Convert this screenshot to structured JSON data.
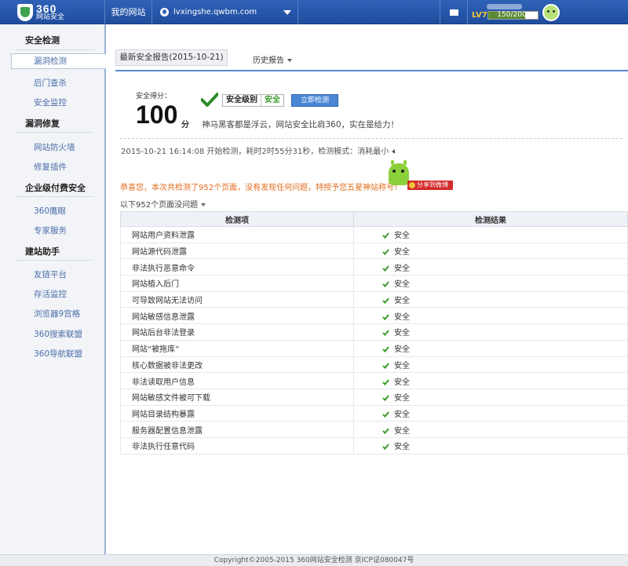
{
  "header": {
    "logo_main": "360",
    "logo_sub": "网站安全",
    "my_site": "我的网站",
    "site_url": "lvxingshe.qwbm.com",
    "level": "LV7",
    "exp_text": "150/200",
    "exp_progress": 0.75
  },
  "sidebar": {
    "groups": [
      {
        "title": "安全检测",
        "items": [
          "漏洞检测",
          "后门查杀",
          "安全监控"
        ]
      },
      {
        "title": "漏洞修复",
        "items": [
          "网站防火墙",
          "修复插件"
        ]
      },
      {
        "title": "企业级付费安全",
        "items": [
          "360鹰眼",
          "专家服务"
        ]
      },
      {
        "title": "建站助手",
        "items": [
          "友链平台",
          "存活监控",
          "浏览器9宫格",
          "360搜索联盟",
          "360导航联盟"
        ]
      }
    ]
  },
  "tabs": {
    "active": "最新安全报告(2015-10-21)",
    "history": "历史报告"
  },
  "score": {
    "label": "安全得分：",
    "value": "100",
    "unit": "分",
    "level_label": "安全级别",
    "level_value": "安全",
    "scan_button": "立即检测",
    "slogan": "神马黑客都是浮云，网站安全比肩360，实在是给力！"
  },
  "scan_info": "2015-10-21 16:14:08 开始检测，耗时2时55分31秒，检测模式：消耗最小",
  "congrats": "恭喜您，本次共检测了952个页面，没有发现任何问题，特授予您五星神站称号！",
  "share_label": "分享到微博",
  "subtitle": "以下952个页面没问题",
  "table": {
    "headers": [
      "检测项",
      "检测结果"
    ],
    "rows": [
      {
        "item": "网站用户资料泄露",
        "result": "安全"
      },
      {
        "item": "网站源代码泄露",
        "result": "安全"
      },
      {
        "item": "非法执行恶意命令",
        "result": "安全"
      },
      {
        "item": "网站植入后门",
        "result": "安全"
      },
      {
        "item": "可导致网站无法访问",
        "result": "安全"
      },
      {
        "item": "网站敏感信息泄露",
        "result": "安全"
      },
      {
        "item": "网站后台非法登录",
        "result": "安全"
      },
      {
        "item": "网站“被拖库”",
        "result": "安全"
      },
      {
        "item": "核心数据被非法更改",
        "result": "安全"
      },
      {
        "item": "非法读取用户信息",
        "result": "安全"
      },
      {
        "item": "网站敏感文件被可下载",
        "result": "安全"
      },
      {
        "item": "网站目录结构暴露",
        "result": "安全"
      },
      {
        "item": "服务器配置信息泄露",
        "result": "安全"
      },
      {
        "item": "非法执行任意代码",
        "result": "安全"
      }
    ]
  },
  "footer": "Copyright©2005-2015 360网站安全检测 京ICP证080047号",
  "colors": {
    "accent": "#2f62b7",
    "ok_green": "#3a9b2a",
    "warn_orange": "#e06a1b"
  }
}
